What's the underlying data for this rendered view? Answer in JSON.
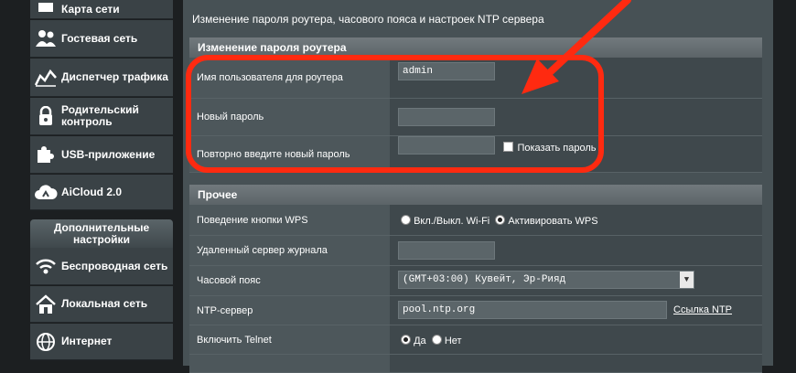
{
  "sidebar": {
    "items": [
      {
        "label": "Карта сети",
        "icon": "network-map-icon"
      },
      {
        "label": "Гостевая сеть",
        "icon": "guest-network-icon"
      },
      {
        "label": "Диспетчер трафика",
        "icon": "traffic-manager-icon"
      },
      {
        "label": "Родительский контроль",
        "icon": "parental-control-icon"
      },
      {
        "label": "USB-приложение",
        "icon": "usb-app-icon"
      },
      {
        "label": "AiCloud 2.0",
        "icon": "cloud-icon"
      }
    ],
    "advanced_header": "Дополнительные настройки",
    "advanced_items": [
      {
        "label": "Беспроводная сеть",
        "icon": "wifi-icon"
      },
      {
        "label": "Локальная сеть",
        "icon": "home-icon"
      },
      {
        "label": "Интернет",
        "icon": "globe-icon"
      }
    ]
  },
  "main": {
    "description": "Изменение пароля роутера, часового пояса и настроек NTP сервера",
    "password_section": {
      "title": "Изменение пароля роутера",
      "username_label": "Имя пользователя для роутера",
      "username_value": "admin",
      "new_password_label": "Новый пароль",
      "new_password_value": "",
      "confirm_password_label": "Повторно введите новый пароль",
      "confirm_password_value": "",
      "show_password_label": "Показать пароль"
    },
    "misc_section": {
      "title": "Прочее",
      "wps_label": "Поведение кнопки WPS",
      "wps_option1": "Вкл./Выкл. Wi-Fi",
      "wps_option2": "Активировать WPS",
      "wps_selected": "Активировать WPS",
      "syslog_label": "Удаленный сервер журнала",
      "syslog_value": "",
      "timezone_label": "Часовой пояс",
      "timezone_value": "(GMT+03:00) Кувейт, Эр-Рияд",
      "ntp_label": "NTP-сервер",
      "ntp_value": "pool.ntp.org",
      "ntp_link": "Ссылка NTP",
      "telnet_label": "Включить Telnet",
      "telnet_yes": "Да",
      "telnet_no": "Нет",
      "telnet_selected": "Да"
    }
  },
  "colors": {
    "annotation": "#ff2a10",
    "panel": "#475155",
    "sidebar_item": "#3a4246"
  }
}
